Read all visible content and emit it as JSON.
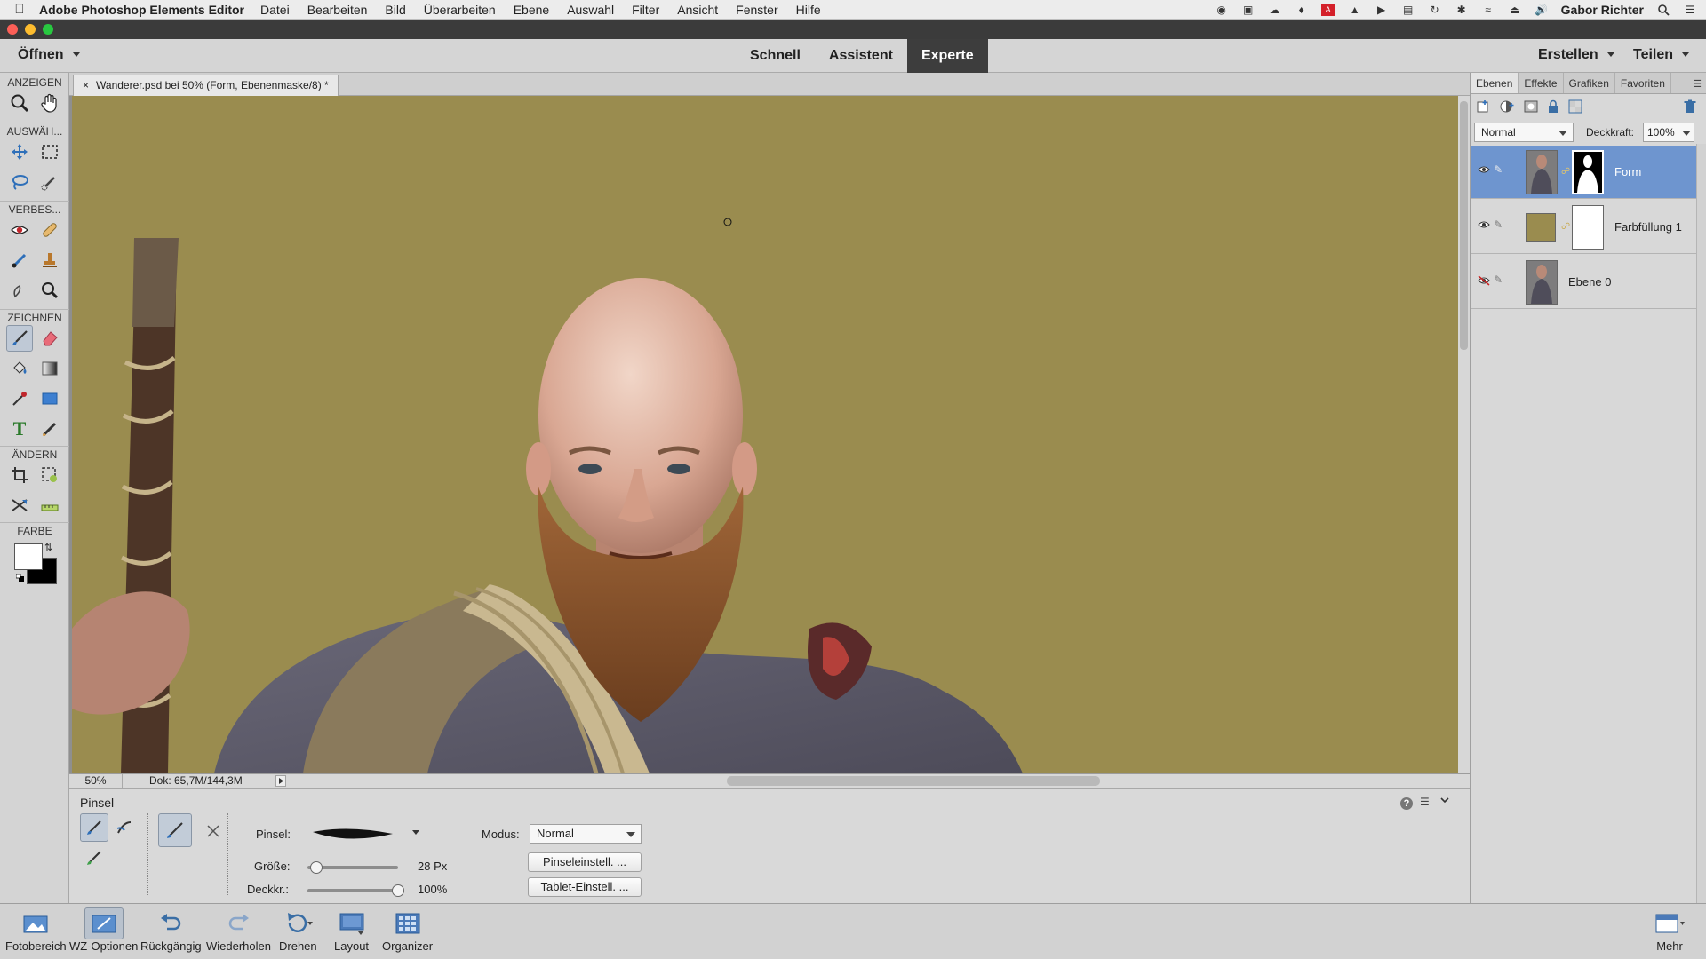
{
  "menubar": {
    "app_name": "Adobe Photoshop Elements Editor",
    "items": [
      "Datei",
      "Bearbeiten",
      "Bild",
      "Überarbeiten",
      "Ebene",
      "Auswahl",
      "Filter",
      "Ansicht",
      "Fenster",
      "Hilfe"
    ],
    "user": "Gabor Richter"
  },
  "appbar": {
    "open_label": "Öffnen",
    "modes": [
      "Schnell",
      "Assistent",
      "Experte"
    ],
    "active_mode": "Experte",
    "create_label": "Erstellen",
    "share_label": "Teilen"
  },
  "toolbox": {
    "sections": [
      "ANZEIGEN",
      "AUSWÄH...",
      "VERBES...",
      "ZEICHNEN",
      "ÄNDERN",
      "FARBE"
    ],
    "foreground_color": "#ffffff",
    "background_color": "#000000"
  },
  "document": {
    "tab_title": "Wanderer.psd bei 50% (Form, Ebenenmaske/8) *",
    "canvas_color": "#9a8c4f"
  },
  "statusbar": {
    "zoom": "50%",
    "doc_size": "Dok: 65,7M/144,3M"
  },
  "tool_options": {
    "title": "Pinsel",
    "brush_label": "Pinsel:",
    "size_label": "Größe:",
    "size_value": "28 Px",
    "size_fraction": 0.1,
    "opacity_label": "Deckkr.:",
    "opacity_value": "100%",
    "opacity_fraction": 1.0,
    "mode_label": "Modus:",
    "mode_value": "Normal",
    "brush_settings_button": "Pinseleinstell. ...",
    "tablet_settings_button": "Tablet-Einstell. ..."
  },
  "layers_panel": {
    "tabs": [
      "Ebenen",
      "Effekte",
      "Grafiken",
      "Favoriten"
    ],
    "active_tab": "Ebenen",
    "blend_mode": "Normal",
    "opacity_label": "Deckkraft:",
    "opacity_value": "100%",
    "layers": [
      {
        "name": "Form",
        "visible": true,
        "selected": true
      },
      {
        "name": "Farbfüllung 1",
        "visible": true,
        "selected": false
      },
      {
        "name": "Ebene 0",
        "visible": false,
        "selected": false
      }
    ]
  },
  "bottombar": {
    "items": [
      "Fotobereich",
      "WZ-Optionen",
      "Rückgängig",
      "Wiederholen",
      "Drehen",
      "Layout",
      "Organizer"
    ],
    "more_label": "Mehr"
  }
}
